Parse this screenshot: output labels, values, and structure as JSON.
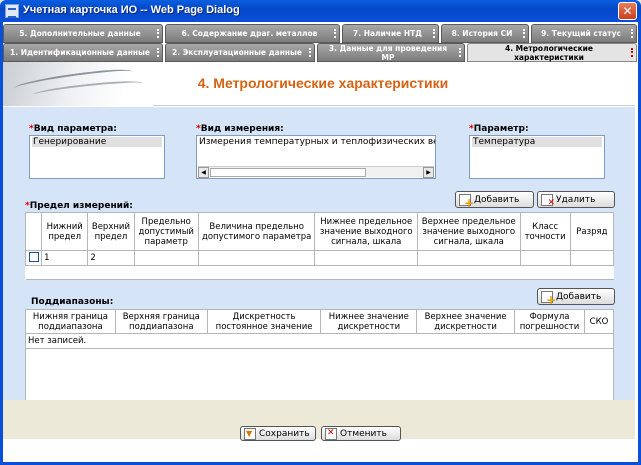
{
  "window": {
    "title": "Учетная карточка ИО -- Web Page Dialog",
    "close": "✕"
  },
  "tabs_top": [
    {
      "label": "5. Дополнительные данные"
    },
    {
      "label": "6. Содержание драг. металлов"
    },
    {
      "label": "7. Наличие НТД"
    },
    {
      "label": "8. История СИ"
    },
    {
      "label": "9. Текущий статус"
    }
  ],
  "tabs_bottom": [
    {
      "label": "1. Идентификационные данные"
    },
    {
      "label": "2. Эксплуатационные данные"
    },
    {
      "label": "3. Данные для проведения МР"
    },
    {
      "label": "4. Метрологические характеристики"
    }
  ],
  "heading": "4. Метрологические характеристики",
  "fields": {
    "param_type": {
      "label": "Вид параметра:",
      "selected": "Генерирование"
    },
    "measure_type": {
      "label": "Вид измерения:",
      "selected": "Измерения температурных и теплофизических вел"
    },
    "parameter": {
      "label": "Параметр:",
      "selected": "Температура"
    }
  },
  "limits": {
    "label": "Предел измерений:",
    "add_label": "Добавить",
    "delete_label": "Удалить",
    "columns": [
      "Нижний предел",
      "Верхний предел",
      "Предельно допустимый параметр",
      "Величина предельно допустимого параметра",
      "Нижнее предельное значение выходного сигнала, шкала",
      "Верхнее предельное значение выходного сигнала, шкала",
      "Класс точности",
      "Разряд"
    ],
    "rows": [
      [
        "1",
        "2",
        "",
        "",
        "",
        "",
        "",
        ""
      ]
    ]
  },
  "subranges": {
    "label": "Поддиапазоны:",
    "add_label": "Добавить",
    "columns": [
      "Нижняя граница поддиапазона",
      "Верхняя граница поддиапазона",
      "Дискретность постоянное значение",
      "Нижнее значение дискретности",
      "Верхнее значение дискретности",
      "Формула погрешности",
      "СКО"
    ],
    "empty_text": "Нет записей."
  },
  "footer": {
    "save_label": "Сохранить",
    "cancel_label": "Отменить"
  },
  "colors": {
    "title_bar": "#0a4fd8",
    "heading": "#d46314",
    "content_bg": "#d6e4f7",
    "tab_bg": "#8c8c8c"
  }
}
